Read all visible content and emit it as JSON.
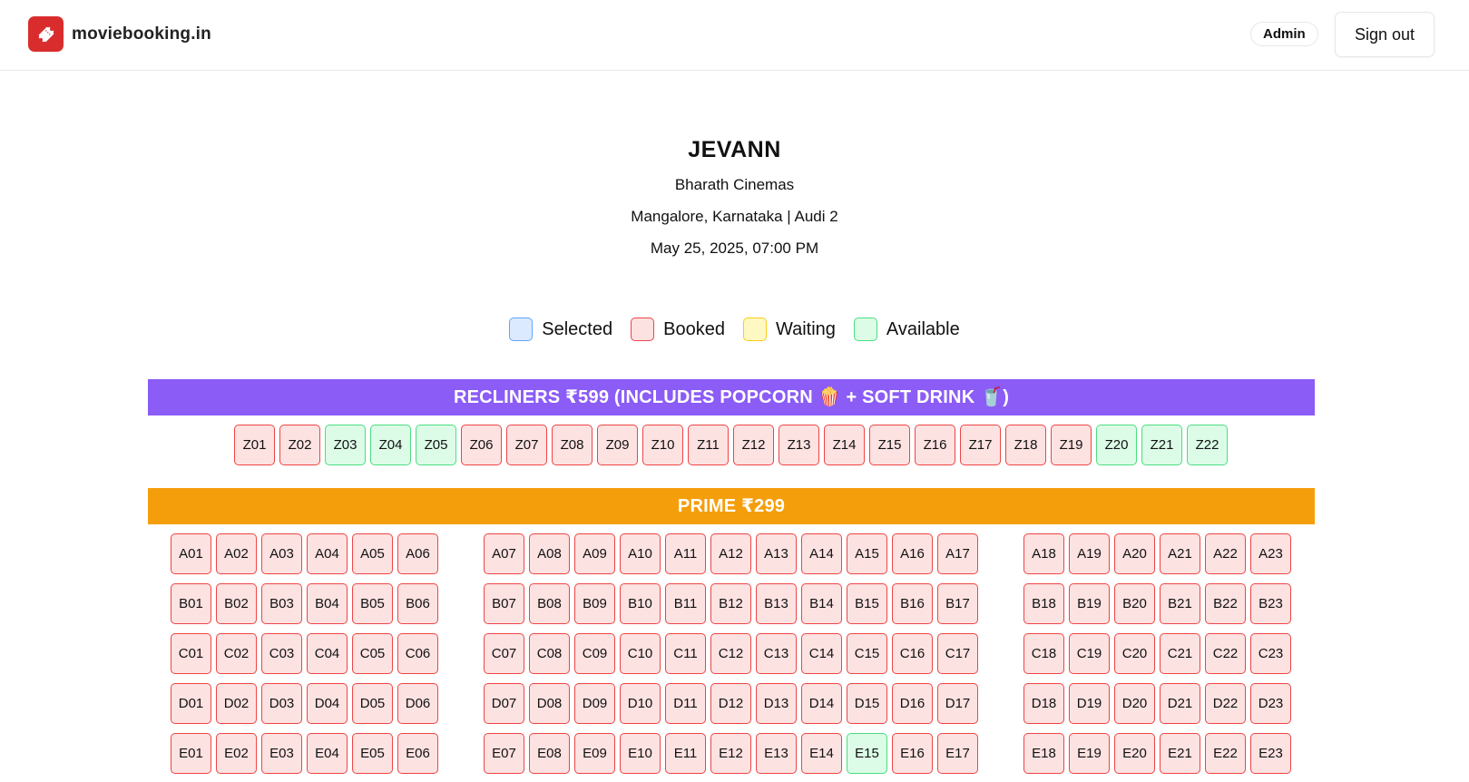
{
  "header": {
    "brand_name": "moviebooking.in",
    "brand_icon": "ticket-icon",
    "admin_label": "Admin",
    "signout_label": "Sign out",
    "brand_color": "#d92d2d"
  },
  "movie": {
    "title": "JEVANN",
    "theatre": "Bharath Cinemas",
    "location": "Mangalore, Karnataka | Audi 2",
    "showtime": "May 25, 2025, 07:00 PM"
  },
  "legend": [
    {
      "label": "Selected",
      "status": "selected"
    },
    {
      "label": "Booked",
      "status": "booked"
    },
    {
      "label": "Waiting",
      "status": "waiting"
    },
    {
      "label": "Available",
      "status": "available"
    }
  ],
  "status_colors": {
    "selected": {
      "fill": "#dbeafe",
      "border": "#60a5fa"
    },
    "booked": {
      "fill": "#fde2e2",
      "border": "#ef4444"
    },
    "waiting": {
      "fill": "#fef9c3",
      "border": "#facc15"
    },
    "available": {
      "fill": "#dcfce7",
      "border": "#4ade80"
    }
  },
  "sections": [
    {
      "name": "RECLINERS ₹599 (INCLUDES POPCORN 🍿 + SOFT DRINK 🥤)",
      "color": "#8b5cf6",
      "rows": [
        [
          [
            "Z01",
            "booked"
          ],
          [
            "Z02",
            "booked"
          ],
          [
            "Z03",
            "available"
          ],
          [
            "Z04",
            "available"
          ],
          [
            "Z05",
            "available"
          ],
          [
            "Z06",
            "booked"
          ],
          [
            "Z07",
            "booked"
          ],
          [
            "Z08",
            "booked"
          ],
          [
            "Z09",
            "booked"
          ],
          [
            "Z10",
            "booked"
          ],
          [
            "Z11",
            "booked"
          ],
          [
            "Z12",
            "booked"
          ],
          [
            "Z13",
            "booked"
          ],
          [
            "Z14",
            "booked"
          ],
          [
            "Z15",
            "booked"
          ],
          [
            "Z16",
            "booked"
          ],
          [
            "Z17",
            "booked"
          ],
          [
            "Z18",
            "booked"
          ],
          [
            "Z19",
            "booked"
          ],
          [
            "Z20",
            "available"
          ],
          [
            "Z21",
            "available"
          ],
          [
            "Z22",
            "available"
          ]
        ]
      ]
    },
    {
      "name": "PRIME ₹299",
      "color": "#f59e0b",
      "rows": [
        [
          [
            "A01",
            "booked"
          ],
          [
            "A02",
            "booked"
          ],
          [
            "A03",
            "booked"
          ],
          [
            "A04",
            "booked"
          ],
          [
            "A05",
            "booked"
          ],
          [
            "A06",
            "booked"
          ],
          [
            "A07",
            "booked"
          ],
          [
            "A08",
            "booked"
          ],
          [
            "A09",
            "booked"
          ],
          [
            "A10",
            "booked"
          ],
          [
            "A11",
            "booked"
          ],
          [
            "A12",
            "booked"
          ],
          [
            "A13",
            "booked"
          ],
          [
            "A14",
            "booked"
          ],
          [
            "A15",
            "booked"
          ],
          [
            "A16",
            "booked"
          ],
          [
            "A17",
            "booked"
          ],
          [
            "A18",
            "booked"
          ],
          [
            "A19",
            "booked"
          ],
          [
            "A20",
            "booked"
          ],
          [
            "A21",
            "booked"
          ],
          [
            "A22",
            "booked"
          ],
          [
            "A23",
            "booked"
          ]
        ],
        [
          [
            "B01",
            "booked"
          ],
          [
            "B02",
            "booked"
          ],
          [
            "B03",
            "booked"
          ],
          [
            "B04",
            "booked"
          ],
          [
            "B05",
            "booked"
          ],
          [
            "B06",
            "booked"
          ],
          [
            "B07",
            "booked"
          ],
          [
            "B08",
            "booked"
          ],
          [
            "B09",
            "booked"
          ],
          [
            "B10",
            "booked"
          ],
          [
            "B11",
            "booked"
          ],
          [
            "B12",
            "booked"
          ],
          [
            "B13",
            "booked"
          ],
          [
            "B14",
            "booked"
          ],
          [
            "B15",
            "booked"
          ],
          [
            "B16",
            "booked"
          ],
          [
            "B17",
            "booked"
          ],
          [
            "B18",
            "booked"
          ],
          [
            "B19",
            "booked"
          ],
          [
            "B20",
            "booked"
          ],
          [
            "B21",
            "booked"
          ],
          [
            "B22",
            "booked"
          ],
          [
            "B23",
            "booked"
          ]
        ],
        [
          [
            "C01",
            "booked"
          ],
          [
            "C02",
            "booked"
          ],
          [
            "C03",
            "booked"
          ],
          [
            "C04",
            "booked"
          ],
          [
            "C05",
            "booked"
          ],
          [
            "C06",
            "booked"
          ],
          [
            "C07",
            "booked"
          ],
          [
            "C08",
            "booked"
          ],
          [
            "C09",
            "booked"
          ],
          [
            "C10",
            "booked"
          ],
          [
            "C11",
            "booked"
          ],
          [
            "C12",
            "booked"
          ],
          [
            "C13",
            "booked"
          ],
          [
            "C14",
            "booked"
          ],
          [
            "C15",
            "booked"
          ],
          [
            "C16",
            "booked"
          ],
          [
            "C17",
            "booked"
          ],
          [
            "C18",
            "booked"
          ],
          [
            "C19",
            "booked"
          ],
          [
            "C20",
            "booked"
          ],
          [
            "C21",
            "booked"
          ],
          [
            "C22",
            "booked"
          ],
          [
            "C23",
            "booked"
          ]
        ],
        [
          [
            "D01",
            "booked"
          ],
          [
            "D02",
            "booked"
          ],
          [
            "D03",
            "booked"
          ],
          [
            "D04",
            "booked"
          ],
          [
            "D05",
            "booked"
          ],
          [
            "D06",
            "booked"
          ],
          [
            "D07",
            "booked"
          ],
          [
            "D08",
            "booked"
          ],
          [
            "D09",
            "booked"
          ],
          [
            "D10",
            "booked"
          ],
          [
            "D11",
            "booked"
          ],
          [
            "D12",
            "booked"
          ],
          [
            "D13",
            "booked"
          ],
          [
            "D14",
            "booked"
          ],
          [
            "D15",
            "booked"
          ],
          [
            "D16",
            "booked"
          ],
          [
            "D17",
            "booked"
          ],
          [
            "D18",
            "booked"
          ],
          [
            "D19",
            "booked"
          ],
          [
            "D20",
            "booked"
          ],
          [
            "D21",
            "booked"
          ],
          [
            "D22",
            "booked"
          ],
          [
            "D23",
            "booked"
          ]
        ],
        [
          [
            "E01",
            "booked"
          ],
          [
            "E02",
            "booked"
          ],
          [
            "E03",
            "booked"
          ],
          [
            "E04",
            "booked"
          ],
          [
            "E05",
            "booked"
          ],
          [
            "E06",
            "booked"
          ],
          [
            "E07",
            "booked"
          ],
          [
            "E08",
            "booked"
          ],
          [
            "E09",
            "booked"
          ],
          [
            "E10",
            "booked"
          ],
          [
            "E11",
            "booked"
          ],
          [
            "E12",
            "booked"
          ],
          [
            "E13",
            "booked"
          ],
          [
            "E14",
            "booked"
          ],
          [
            "E15",
            "available"
          ],
          [
            "E16",
            "booked"
          ],
          [
            "E17",
            "booked"
          ],
          [
            "E18",
            "booked"
          ],
          [
            "E19",
            "booked"
          ],
          [
            "E20",
            "booked"
          ],
          [
            "E21",
            "booked"
          ],
          [
            "E22",
            "booked"
          ],
          [
            "E23",
            "booked"
          ]
        ]
      ]
    }
  ]
}
